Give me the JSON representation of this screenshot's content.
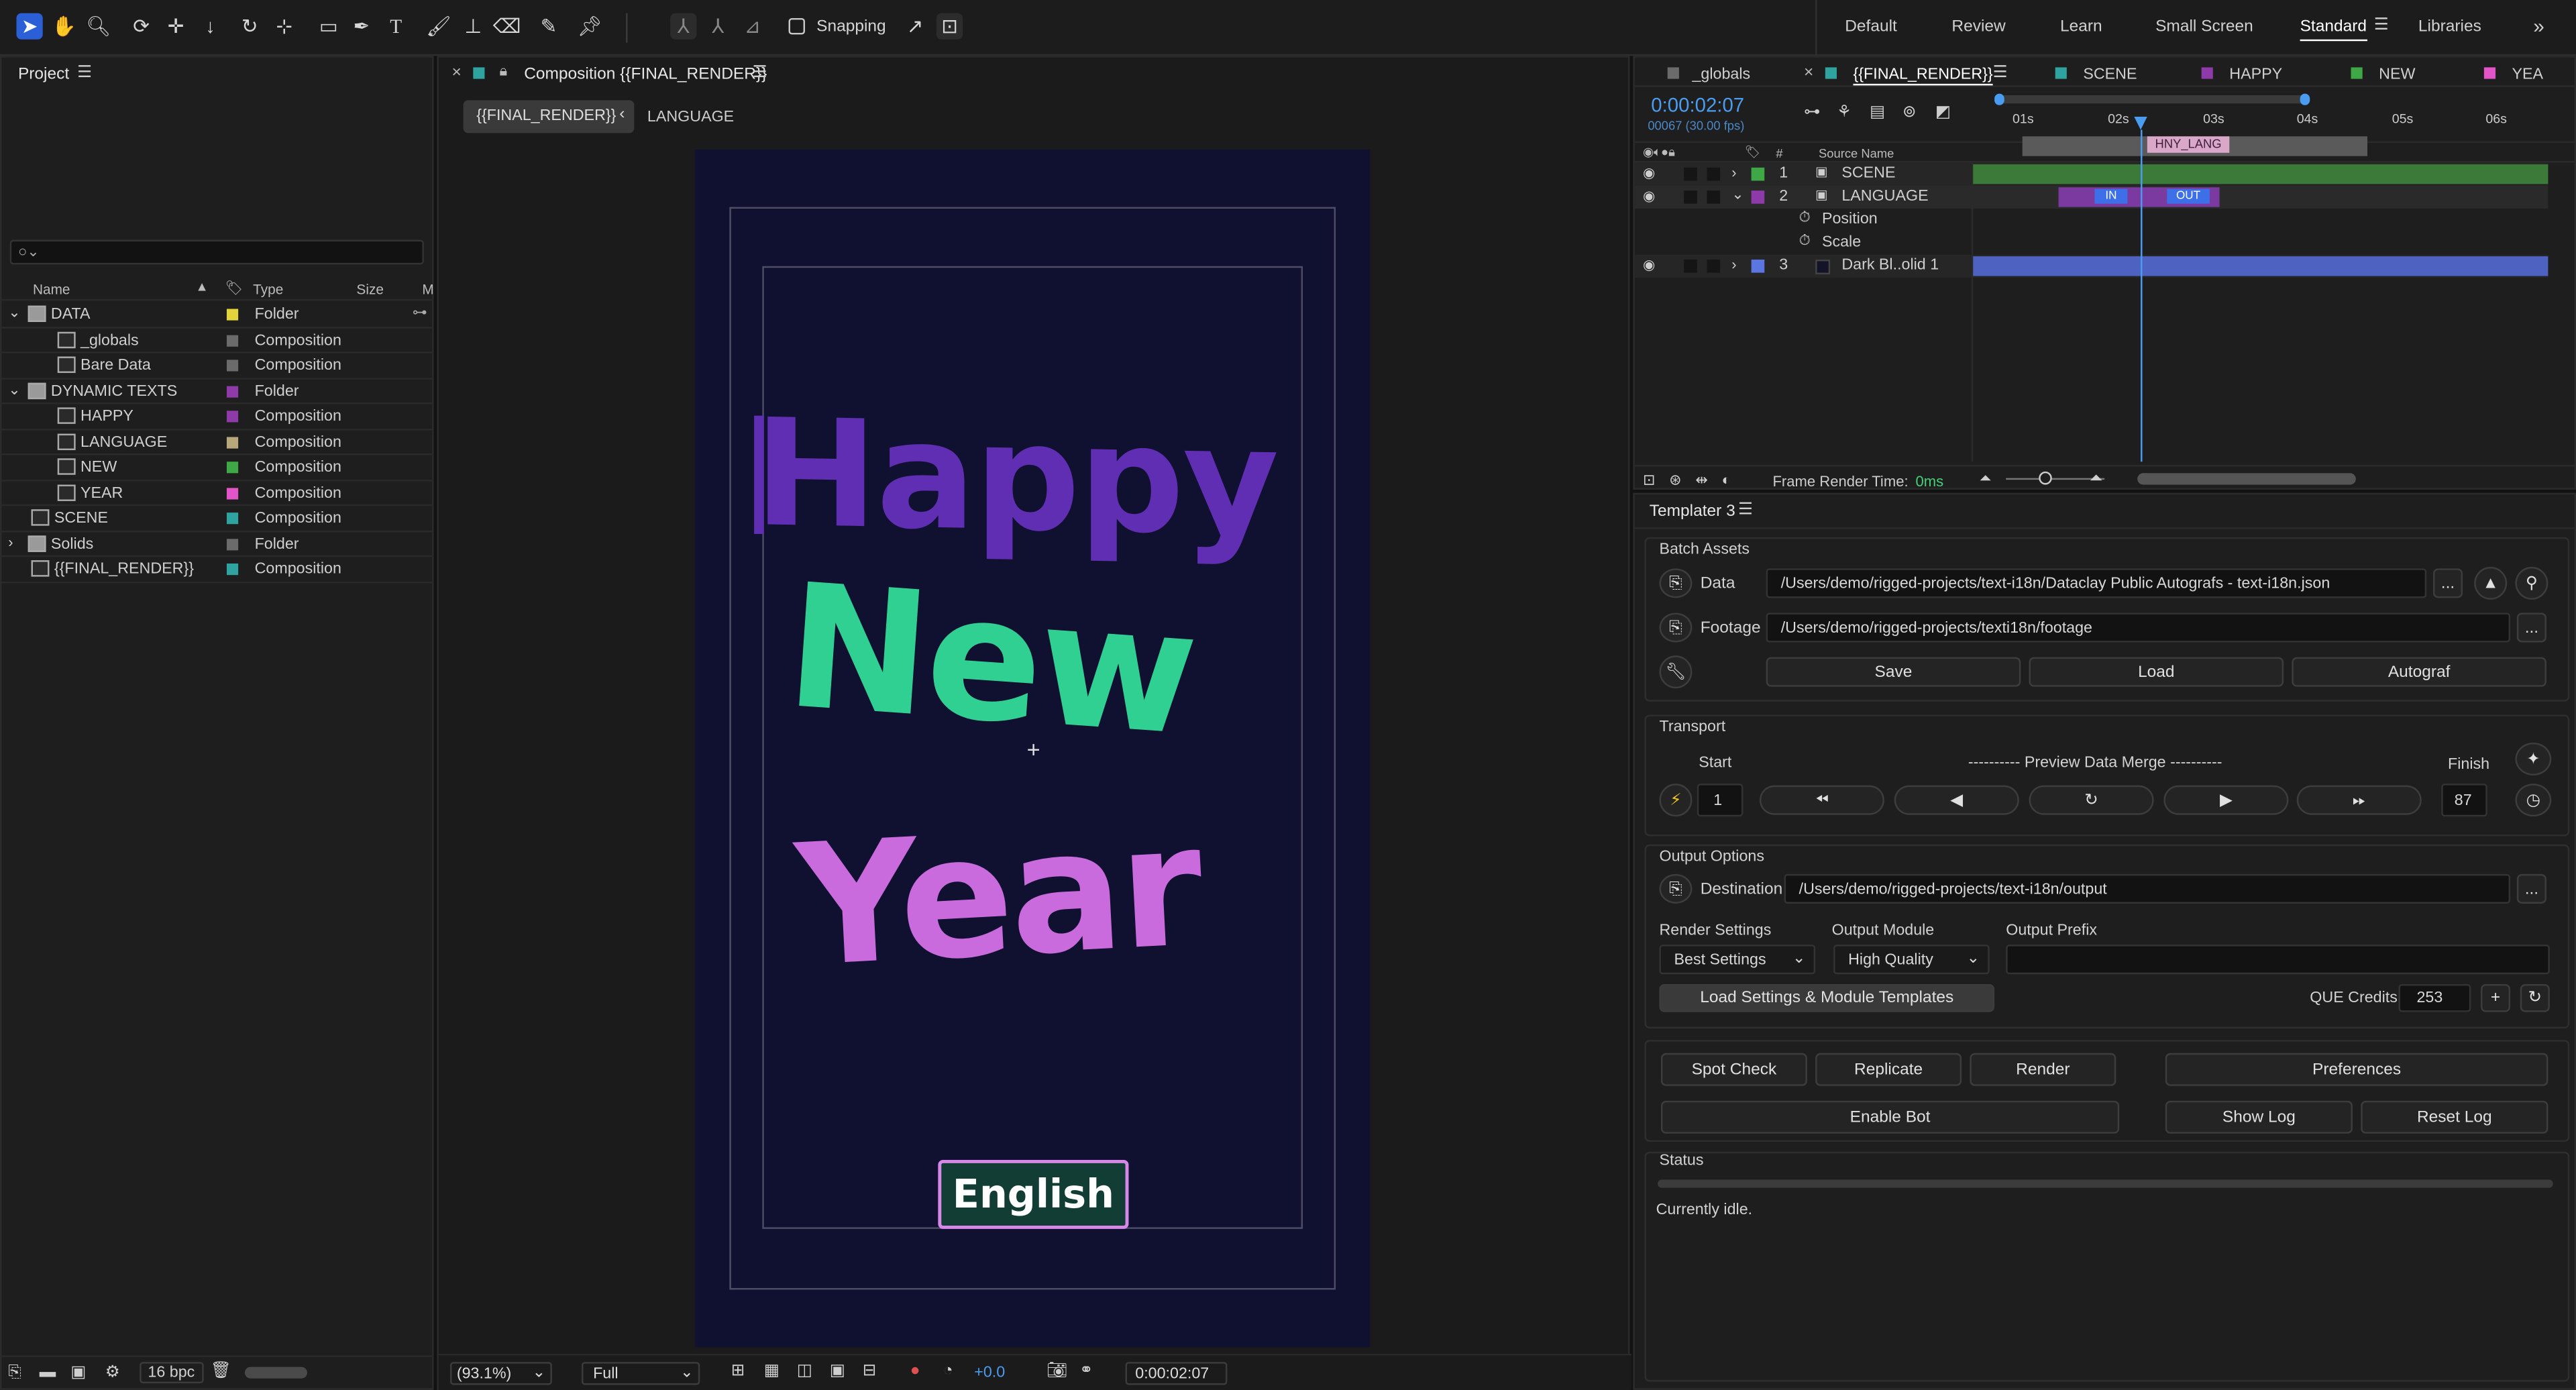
{
  "toolbar": {
    "snapping_label": "Snapping",
    "workspaces": [
      "Default",
      "Review",
      "Learn",
      "Small Screen",
      "Standard",
      "Libraries"
    ]
  },
  "project": {
    "title": "Project",
    "columns": {
      "name": "Name",
      "type": "Type",
      "size": "Size",
      "m": "M"
    },
    "items": [
      {
        "name": "DATA",
        "type": "Folder",
        "color": "#e2d43a",
        "kind": "folder",
        "expanded": true,
        "indent": 0
      },
      {
        "name": "_globals",
        "type": "Composition",
        "color": "#6b6b6b",
        "kind": "comp",
        "indent": 1
      },
      {
        "name": "Bare Data",
        "type": "Composition",
        "color": "#6b6b6b",
        "kind": "comp",
        "indent": 1
      },
      {
        "name": "DYNAMIC TEXTS",
        "type": "Folder",
        "color": "#8e3aa8",
        "kind": "folder",
        "expanded": true,
        "indent": 0
      },
      {
        "name": "HAPPY",
        "type": "Composition",
        "color": "#8e3aa8",
        "kind": "comp",
        "indent": 1
      },
      {
        "name": "LANGUAGE",
        "type": "Composition",
        "color": "#b9a97a",
        "kind": "comp",
        "indent": 1
      },
      {
        "name": "NEW",
        "type": "Composition",
        "color": "#3fa846",
        "kind": "comp",
        "indent": 1
      },
      {
        "name": "YEAR",
        "type": "Composition",
        "color": "#e155c6",
        "kind": "comp",
        "indent": 1
      },
      {
        "name": "SCENE",
        "type": "Composition",
        "color": "#2fa39f",
        "kind": "comp",
        "indent": 0
      },
      {
        "name": "Solids",
        "type": "Folder",
        "color": "#6b6b6b",
        "kind": "folder",
        "expanded": false,
        "indent": 0
      },
      {
        "name": "{{FINAL_RENDER}}",
        "type": "Composition",
        "color": "#2fa39f",
        "kind": "comp",
        "indent": 0
      }
    ],
    "bpc": "16 bpc"
  },
  "comp": {
    "title": "Composition {{FINAL_RENDER}}",
    "breadcrumb_active": "{{FINAL_RENDER}}",
    "breadcrumb_next": "LANGUAGE",
    "text_happy": "Happy",
    "text_new": "New",
    "text_year": "Year",
    "text_english": "English",
    "zoom": "(93.1%)",
    "resolution": "Full",
    "exposure": "+0.0",
    "timecode": "0:00:02:07"
  },
  "timeline": {
    "tabs": [
      "_globals",
      "{{FINAL_RENDER}}",
      "SCENE",
      "HAPPY",
      "NEW",
      "YEA"
    ],
    "tab_colors": [
      "#6b6b6b",
      "#2fa39f",
      "#2fa39f",
      "#8e3aa8",
      "#3fa846",
      "#e155c6"
    ],
    "timecode": "0:00:02:07",
    "frames": "00067 (30.00 fps)",
    "ruler": [
      "01s",
      "02s",
      "03s",
      "04s",
      "05s",
      "06s"
    ],
    "source_name_header": "Source Name",
    "hash_header": "#",
    "layers": [
      {
        "num": "1",
        "name": "SCENE",
        "color": "#3fa846"
      },
      {
        "num": "2",
        "name": "LANGUAGE",
        "color": "#8e3aa8"
      },
      {
        "num": "3",
        "name": "Dark Bl..olid 1",
        "color": "#5b76e0"
      }
    ],
    "props": [
      "Position",
      "Scale"
    ],
    "marker_top": "HNY_LANG",
    "marker_in": "IN",
    "marker_out": "OUT",
    "frame_render_label": "Frame Render Time:",
    "frame_render_value": "0ms"
  },
  "templater": {
    "title": "Templater 3",
    "batch_assets": "Batch Assets",
    "data_label": "Data",
    "data_path": "/Users/demo/rigged-projects/text-i18n/Dataclay Public Autografs - text-i18n.json",
    "footage_label": "Footage",
    "footage_path": "/Users/demo/rigged-projects/texti18n/footage",
    "save": "Save",
    "load": "Load",
    "autograf": "Autograf",
    "transport": "Transport",
    "start": "Start",
    "preview": "---------- Preview Data Merge ----------",
    "finish": "Finish",
    "start_value": "1",
    "finish_value": "87",
    "output_options": "Output Options",
    "destination_label": "Destination",
    "destination_path": "/Users/demo/rigged-projects/text-i18n/output",
    "render_settings_label": "Render Settings",
    "output_module_label": "Output Module",
    "output_prefix_label": "Output Prefix",
    "render_settings_value": "Best Settings",
    "output_module_value": "High Quality",
    "load_templates": "Load Settings & Module Templates",
    "que_credits_label": "QUE Credits",
    "que_credits_value": "253",
    "spot_check": "Spot Check",
    "replicate": "Replicate",
    "render": "Render",
    "preferences": "Preferences",
    "enable_bot": "Enable Bot",
    "show_log": "Show Log",
    "reset_log": "Reset Log",
    "status_label": "Status",
    "status_text": "Currently idle.",
    "dots": "..."
  }
}
